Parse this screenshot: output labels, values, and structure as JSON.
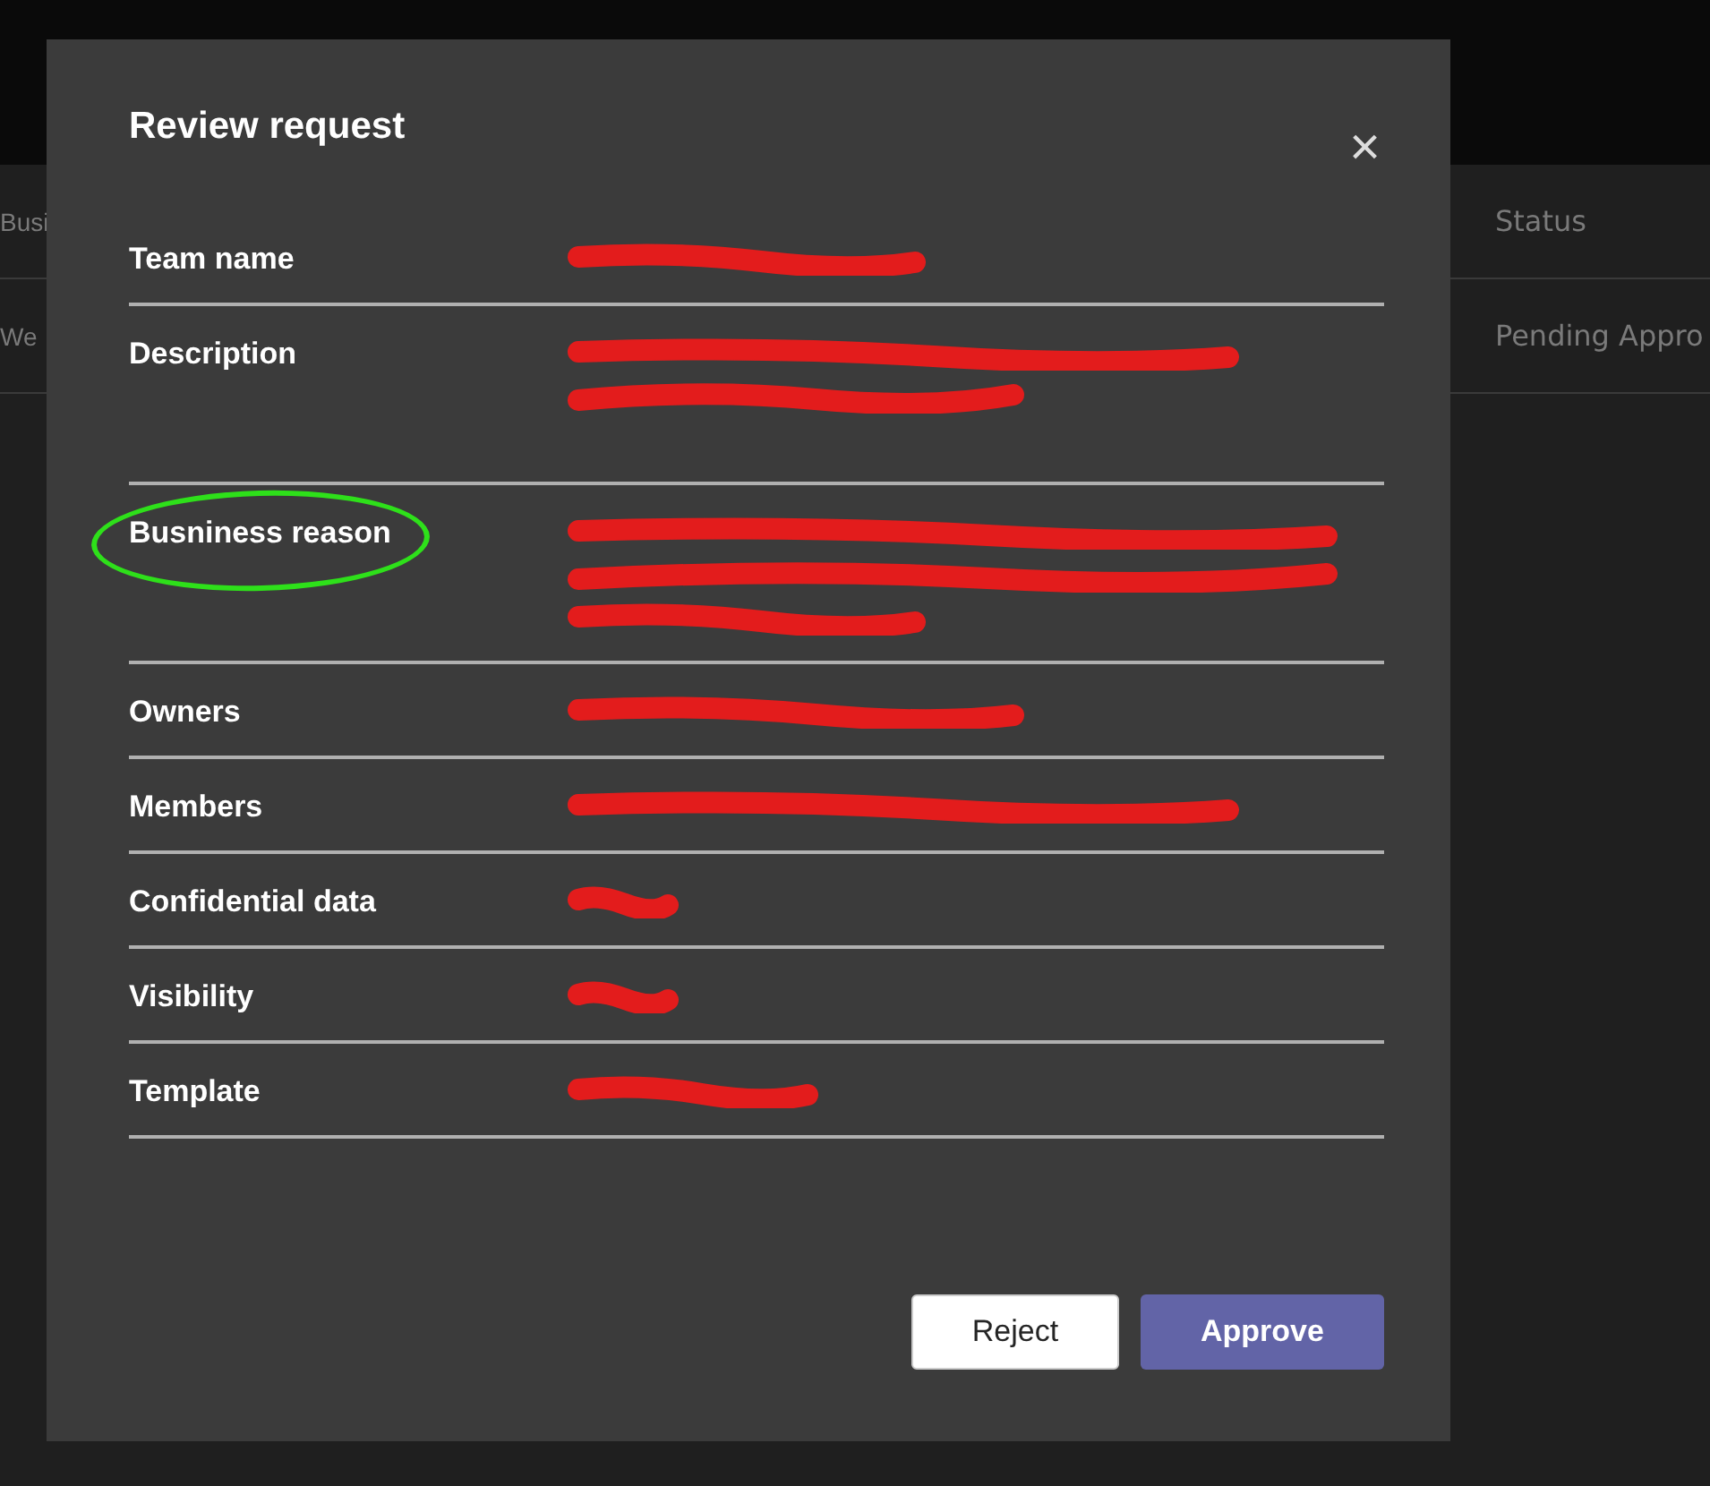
{
  "background_table": {
    "columns": [
      {
        "label": "Busi"
      },
      {
        "label": "Status"
      }
    ],
    "rows": [
      {
        "cells": [
          "We",
          "Pending Appro"
        ]
      }
    ]
  },
  "dialog": {
    "title": "Review request",
    "close": "×",
    "fields": [
      {
        "label": "Team name",
        "circled": false,
        "redactions": [
          {
            "kind": "medium"
          }
        ]
      },
      {
        "label": "Description",
        "circled": false,
        "redactions": [
          {
            "kind": "wide"
          },
          {
            "kind": "large"
          }
        ]
      },
      {
        "label": "Busniness reason",
        "circled": true,
        "redactions": [
          {
            "kind": "full"
          },
          {
            "kind": "full"
          },
          {
            "kind": "medium"
          }
        ]
      },
      {
        "label": "Owners",
        "circled": false,
        "redactions": [
          {
            "kind": "large"
          }
        ]
      },
      {
        "label": "Members",
        "circled": false,
        "redactions": [
          {
            "kind": "wide"
          }
        ]
      },
      {
        "label": "Confidential data",
        "circled": false,
        "redactions": [
          {
            "kind": "tiny"
          }
        ]
      },
      {
        "label": "Visibility",
        "circled": false,
        "redactions": [
          {
            "kind": "tiny"
          }
        ]
      },
      {
        "label": "Template",
        "circled": false,
        "redactions": [
          {
            "kind": "small"
          }
        ]
      }
    ],
    "buttons": [
      {
        "label": "Reject",
        "kind": "secondary"
      },
      {
        "label": "Approve",
        "kind": "primary"
      }
    ]
  }
}
